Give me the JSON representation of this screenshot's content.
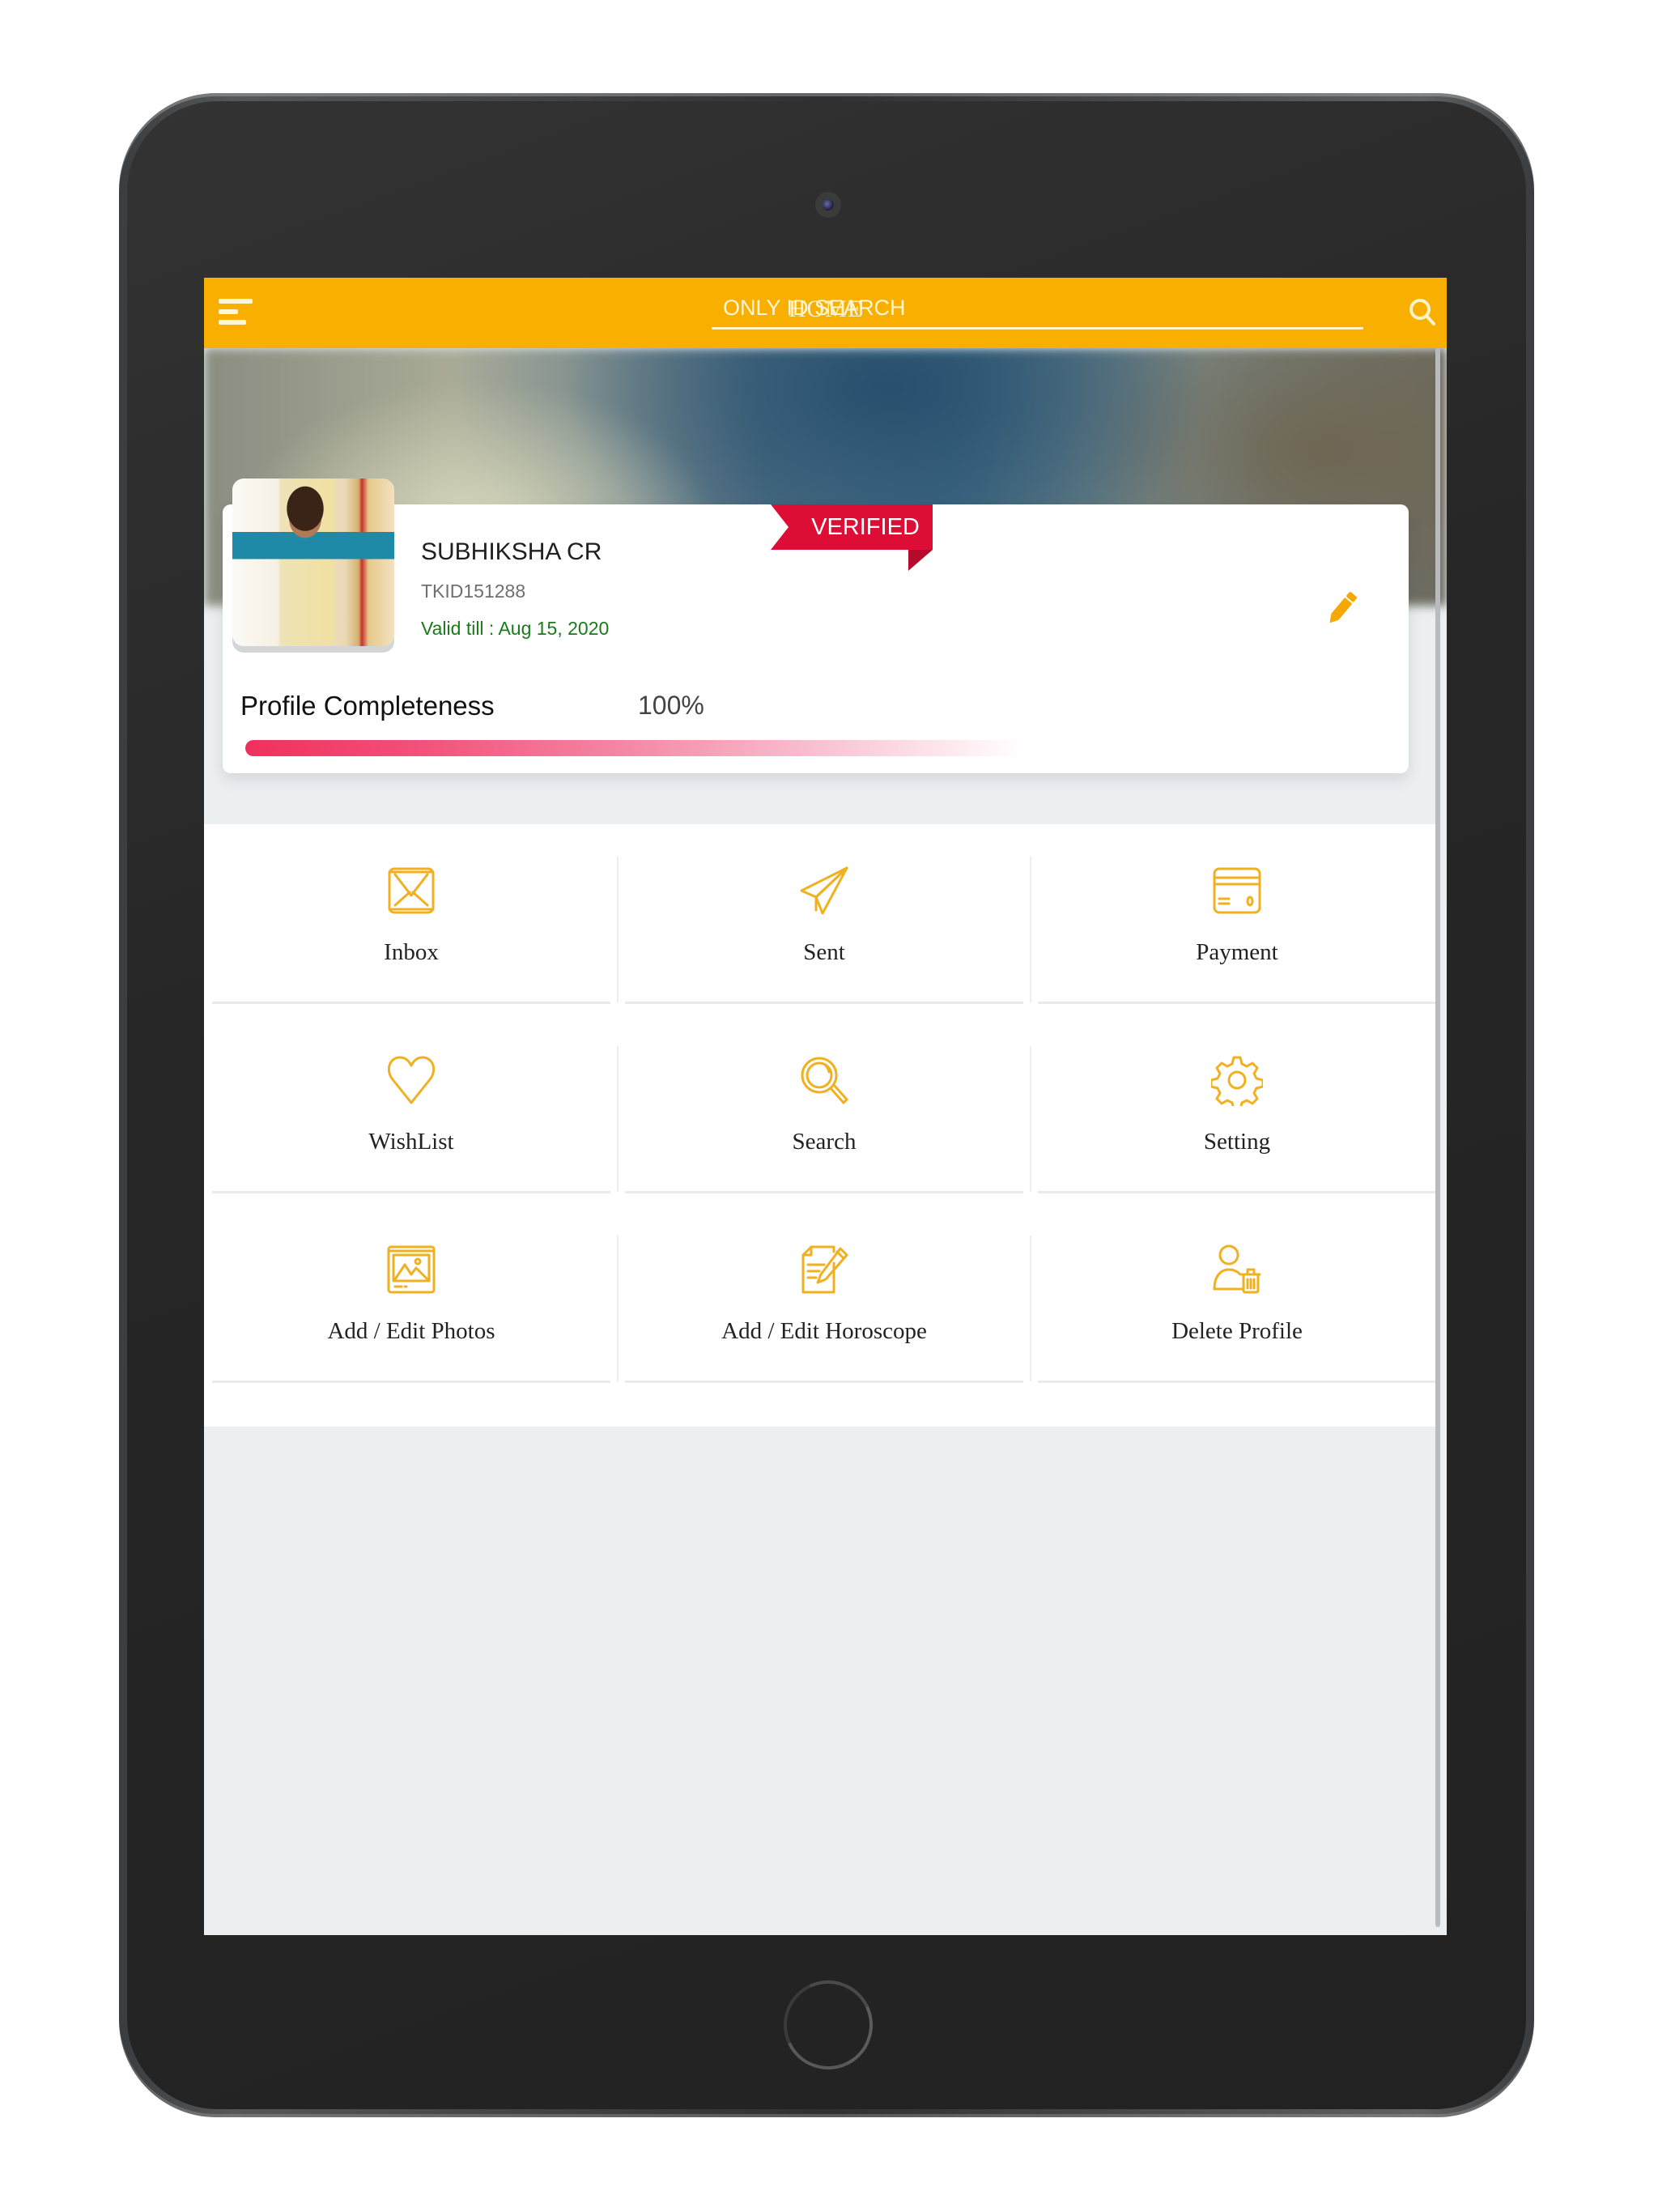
{
  "app": {
    "title": "HOME",
    "search_placeholder": "ONLY ID SEARCH",
    "menu_icon": "hamburger-menu-icon",
    "search_icon": "search-icon",
    "accent_color": "#f9af00"
  },
  "profile": {
    "name": "SUBHIKSHA CR",
    "id": "TKID151288",
    "validity": "Valid till : Aug 15, 2020",
    "badge": "VERIFIED",
    "badge_color": "#dd0d35",
    "edit_icon": "pencil-icon",
    "completeness_label": "Profile Completeness",
    "completeness_value": "100%",
    "completeness_fraction": 1.0
  },
  "menu": [
    {
      "label": "Inbox",
      "icon": "envelope-icon"
    },
    {
      "label": "Sent",
      "icon": "paper-plane-icon"
    },
    {
      "label": "Payment",
      "icon": "credit-card-icon"
    },
    {
      "label": "WishList",
      "icon": "heart-icon"
    },
    {
      "label": "Search",
      "icon": "magnifier-icon"
    },
    {
      "label": "Setting",
      "icon": "gear-icon"
    },
    {
      "label": "Add / Edit Photos",
      "icon": "photo-gallery-icon"
    },
    {
      "label": "Add / Edit Horoscope",
      "icon": "document-edit-icon"
    },
    {
      "label": "Delete Profile",
      "icon": "user-delete-icon"
    }
  ]
}
